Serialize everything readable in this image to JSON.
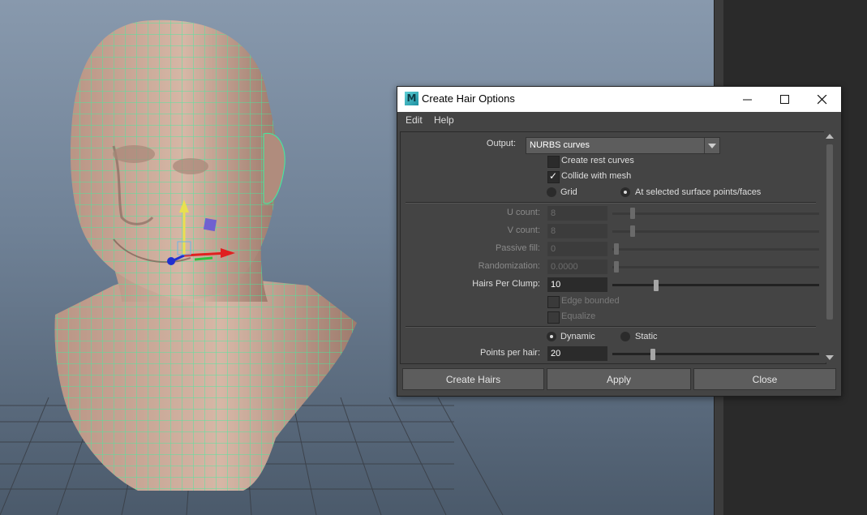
{
  "window": {
    "title": "Create Hair Options",
    "icon_letter": "M",
    "minimize_icon": "minimize-icon",
    "maximize_icon": "maximize-icon",
    "close_icon": "close-icon"
  },
  "menu": [
    {
      "label": "Edit"
    },
    {
      "label": "Help"
    }
  ],
  "options": {
    "output_label": "Output:",
    "output_value": "NURBS curves",
    "create_rest_curves": {
      "label": "Create rest curves",
      "checked": false
    },
    "collide_with_mesh": {
      "label": "Collide with mesh",
      "checked": true
    },
    "placement": {
      "grid": "Grid",
      "selected": "At selected surface points/faces",
      "value": "selected"
    },
    "u_count": {
      "label": "U count:",
      "value": "8",
      "slider": 0.1,
      "enabled": false
    },
    "v_count": {
      "label": "V count:",
      "value": "8",
      "slider": 0.1,
      "enabled": false
    },
    "passive_fill": {
      "label": "Passive fill:",
      "value": "0",
      "slider": 0.0,
      "enabled": false
    },
    "randomization": {
      "label": "Randomization:",
      "value": "0.0000",
      "slider": 0.0,
      "enabled": false
    },
    "hairs_per_clump": {
      "label": "Hairs Per Clump:",
      "value": "10",
      "slider": 0.22,
      "enabled": true
    },
    "edge_bounded": {
      "label": "Edge bounded",
      "checked": false,
      "enabled": false
    },
    "equalize": {
      "label": "Equalize",
      "checked": false,
      "enabled": false
    },
    "dynamics": {
      "dynamic": "Dynamic",
      "static": "Static",
      "value": "dynamic"
    },
    "points_per_hair": {
      "label": "Points per hair:",
      "value": "20",
      "slider": 0.2,
      "enabled": true
    }
  },
  "buttons": {
    "create_hairs": "Create Hairs",
    "apply": "Apply",
    "close": "Close"
  },
  "colors": {
    "wireframe": "#3cf0a0",
    "skin": "#c6a392",
    "viewport_top": "#8899ad",
    "viewport_bottom": "#4b5a6b"
  }
}
